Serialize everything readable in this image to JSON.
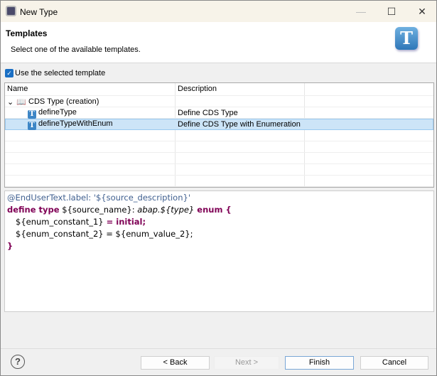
{
  "window": {
    "title": "New Type"
  },
  "header": {
    "title": "Templates",
    "description": "Select one of the available templates.",
    "logo": "T"
  },
  "use_template": {
    "label": "Use the selected template",
    "checked": true
  },
  "table": {
    "columns": [
      "Name",
      "Description"
    ],
    "group": {
      "name": "CDS Type (creation)"
    },
    "rows": [
      {
        "name": "defineType",
        "description": "Define CDS Type"
      },
      {
        "name": "defineTypeWithEnum",
        "description": "Define CDS Type with Enumeration",
        "selected": true
      }
    ]
  },
  "code": {
    "l1": "@EndUserText.label: '${source_description}'",
    "l2a": "define type",
    "l2b": " ${source_name}: ",
    "l2c": "abap.${type}",
    "l2d": " enum {",
    "l3a": "${enum_constant_1}",
    "l3b": " = initial;",
    "l4": "${enum_constant_2} = ${enum_value_2};",
    "l5": "}"
  },
  "buttons": {
    "back": "< Back",
    "next": "Next >",
    "finish": "Finish",
    "cancel": "Cancel",
    "help": "?"
  }
}
